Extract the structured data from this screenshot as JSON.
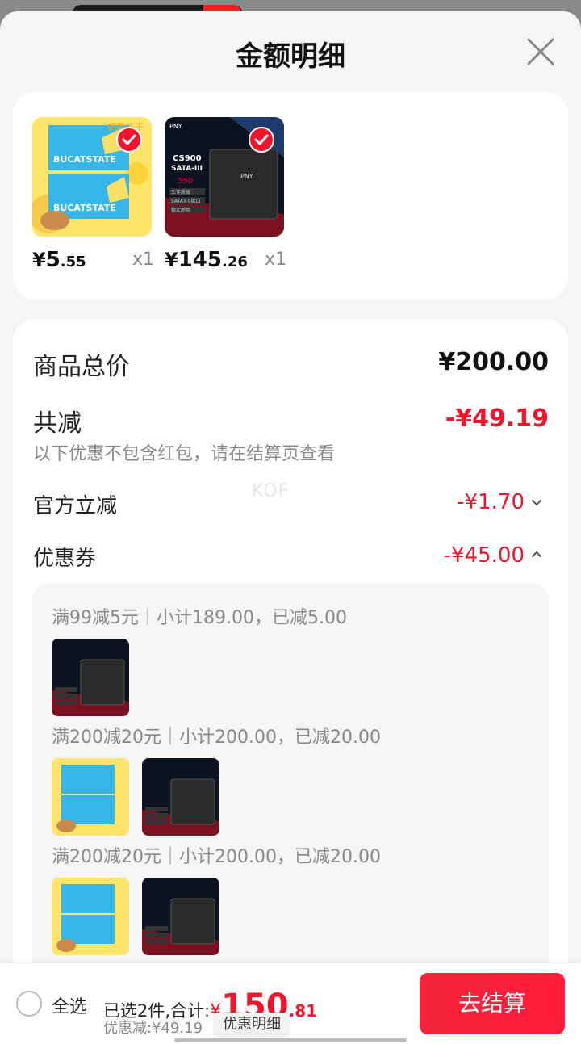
{
  "sheet": {
    "title": "金额明细"
  },
  "products": [
    {
      "name": "BUCATSTATE",
      "price_int": "5",
      "price_dec": ".55",
      "currency": "¥",
      "qty": "x1",
      "checked": true
    },
    {
      "name": "PNY CS900 SATA-III",
      "price_int": "145",
      "price_dec": ".26",
      "currency": "¥",
      "qty": "x1",
      "checked": true
    }
  ],
  "thumb_text": {
    "cheese_brand": "BUCATSTATE",
    "cheese_tag": "奶酪冻干",
    "ssd_brand": "PNY",
    "ssd_model": "CS900",
    "ssd_iface": "SATA-III",
    "ssd_speed": "550",
    "ssd_spec1": "三年质保",
    "ssd_spec2": "SATA3.0接口",
    "ssd_spec3": "稳定耐用"
  },
  "summary": {
    "total_label": "商品总价",
    "total_value": "¥200.00",
    "reduce_label": "共减",
    "reduce_value": "-¥49.19",
    "note": "以下优惠不包含红包，请在结算页查看",
    "official_label": "官方立减",
    "official_value": "-¥1.70",
    "coupon_label": "优惠券",
    "coupon_value": "-¥45.00"
  },
  "coupons": [
    {
      "text": "满99减5元｜小计189.00，已减5.00",
      "items": [
        "ssd"
      ]
    },
    {
      "text": "满200减20元｜小计200.00，已减20.00",
      "items": [
        "cheese",
        "ssd"
      ]
    },
    {
      "text": "满200减20元｜小计200.00，已减20.00",
      "items": [
        "cheese",
        "ssd"
      ]
    }
  ],
  "watermark": "KOF",
  "bottom": {
    "select_all": "全选",
    "selected_text": "已选2件,合计:",
    "currency": "¥",
    "total_int": "150",
    "total_dec": ".81",
    "discount_text": "优惠减:¥49.19",
    "detail_chip": "优惠明细",
    "checkout": "去结算"
  },
  "colors": {
    "accent_red": "#f0142d",
    "sheet_bg": "#f5f5f5",
    "card_bg": "#ffffff"
  }
}
